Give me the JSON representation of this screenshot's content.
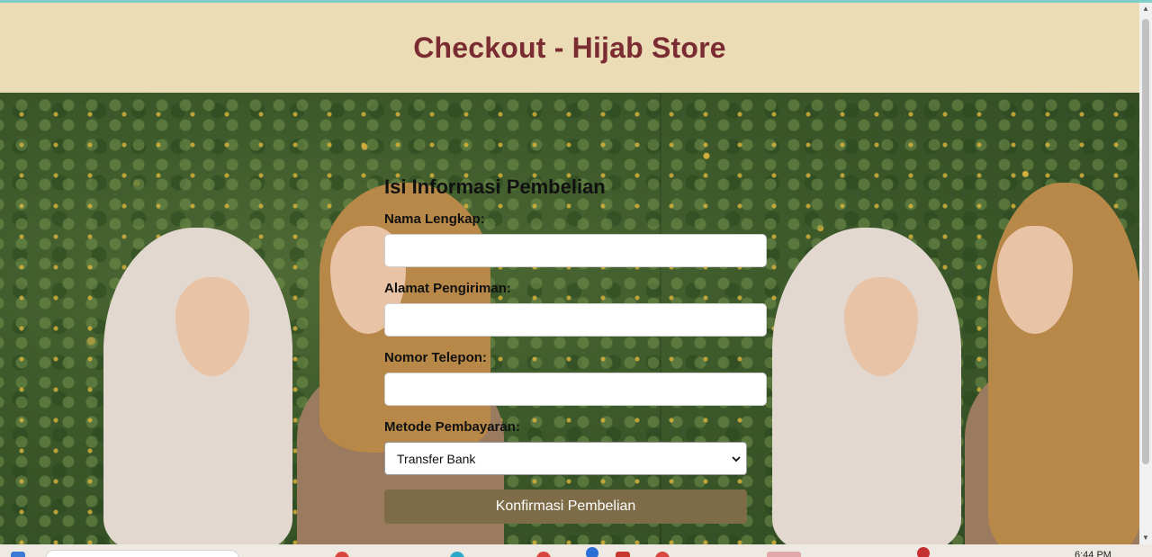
{
  "header": {
    "title": "Checkout - Hijab Store"
  },
  "form": {
    "heading": "Isi Informasi Pembelian",
    "fields": [
      {
        "label": "Nama Lengkap:",
        "value": ""
      },
      {
        "label": "Alamat Pengiriman:",
        "value": ""
      },
      {
        "label": "Nomor Telepon:",
        "value": ""
      }
    ],
    "payment": {
      "label": "Metode Pembayaran:",
      "selected": "Transfer Bank"
    },
    "submit_label": "Konfirmasi Pembelian"
  },
  "taskbar": {
    "time": "6:44 PM"
  },
  "colors": {
    "header_bg": "#ebdcb5",
    "title": "#7b2c33",
    "button_bg": "#7d6c47",
    "button_text": "#ffffff"
  },
  "icons": [
    "chevron-down-icon",
    "scroll-up-arrow",
    "scroll-down-arrow"
  ]
}
